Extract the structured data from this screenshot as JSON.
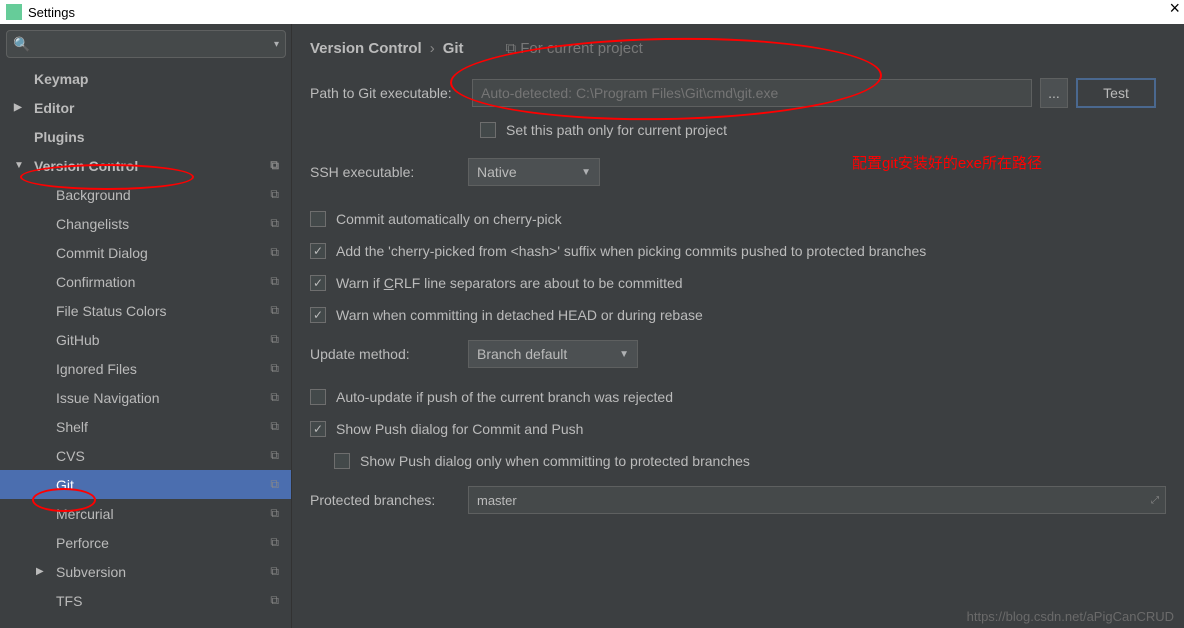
{
  "titlebar": {
    "title": "Settings"
  },
  "sidebar": {
    "items": [
      {
        "label": "Keymap"
      },
      {
        "label": "Editor"
      },
      {
        "label": "Plugins"
      },
      {
        "label": "Version Control"
      },
      {
        "label": "Background"
      },
      {
        "label": "Changelists"
      },
      {
        "label": "Commit Dialog"
      },
      {
        "label": "Confirmation"
      },
      {
        "label": "File Status Colors"
      },
      {
        "label": "GitHub"
      },
      {
        "label": "Ignored Files"
      },
      {
        "label": "Issue Navigation"
      },
      {
        "label": "Shelf"
      },
      {
        "label": "CVS"
      },
      {
        "label": "Git"
      },
      {
        "label": "Mercurial"
      },
      {
        "label": "Perforce"
      },
      {
        "label": "Subversion"
      },
      {
        "label": "TFS"
      }
    ]
  },
  "breadcrumb": {
    "vc": "Version Control",
    "git": "Git",
    "proj": "For current project"
  },
  "form": {
    "path_label": "Path to Git executable:",
    "path_placeholder": "Auto-detected: C:\\Program Files\\Git\\cmd\\git.exe",
    "dots": "...",
    "test": "Test",
    "set_path_only": "Set this path only for current project",
    "ssh_label": "SSH executable:",
    "ssh_value": "Native",
    "chk_cherry_auto": "Commit automatically on cherry-pick",
    "chk_cherry_suffix": "Add the 'cherry-picked from <hash>' suffix when picking commits pushed to protected branches",
    "chk_crlf_pre": "Warn if ",
    "chk_crlf_u": "C",
    "chk_crlf_post": "RLF line separators are about to be committed",
    "chk_detached": "Warn when committing in detached HEAD or during rebase",
    "update_label": "Update method:",
    "update_value": "Branch default",
    "chk_autoupdate": "Auto-update if push of the current branch was rejected",
    "chk_show_push": "Show Push dialog for Commit and Push",
    "chk_show_push_protected": "Show Push dialog only when committing to protected branches",
    "protected_label": "Protected branches:",
    "protected_value": "master"
  },
  "annotation": {
    "text": "配置git安装好的exe所在路径"
  },
  "watermark": "https://blog.csdn.net/aPigCanCRUD"
}
